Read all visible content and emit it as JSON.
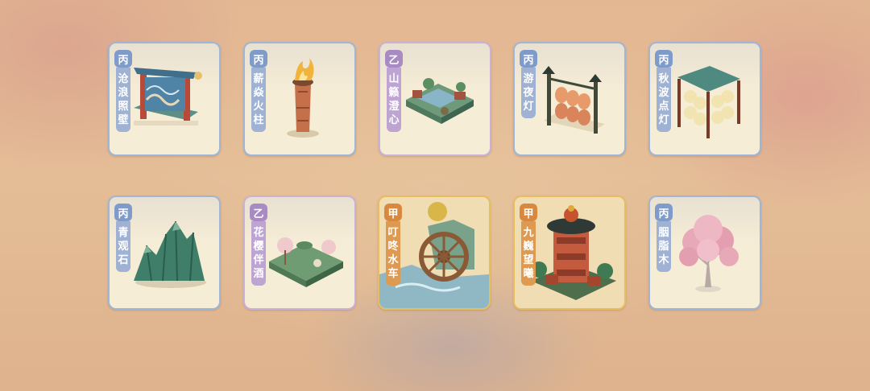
{
  "items": [
    {
      "grade": "丙",
      "name": "沧浪照壁",
      "tier": "bing",
      "icon": "screen-wall-icon"
    },
    {
      "grade": "丙",
      "name": "薪焱火柱",
      "tier": "bing",
      "icon": "fire-pillar-icon"
    },
    {
      "grade": "乙",
      "name": "山籁澄心",
      "tier": "yi",
      "icon": "garden-courtyard-icon"
    },
    {
      "grade": "丙",
      "name": "游夜灯",
      "tier": "bing",
      "icon": "night-lantern-icon"
    },
    {
      "grade": "丙",
      "name": "秋波点灯",
      "tier": "bing",
      "icon": "lantern-rack-icon"
    },
    {
      "grade": "丙",
      "name": "青观石",
      "tier": "bing",
      "icon": "green-rock-icon"
    },
    {
      "grade": "乙",
      "name": "花樱伴酒",
      "tier": "yi",
      "icon": "cherry-blossom-terrace-icon"
    },
    {
      "grade": "甲",
      "name": "叮咚水车",
      "tier": "jia",
      "icon": "water-wheel-icon"
    },
    {
      "grade": "甲",
      "name": "九巍望曦",
      "tier": "jia",
      "icon": "tower-pavilion-icon"
    },
    {
      "grade": "丙",
      "name": "胭脂木",
      "tier": "bing",
      "icon": "pink-tree-icon"
    }
  ]
}
